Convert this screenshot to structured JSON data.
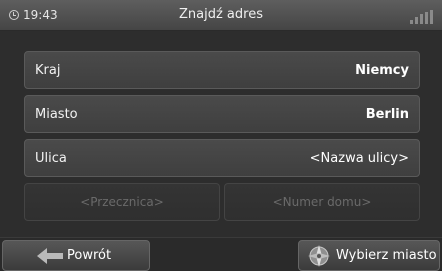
{
  "status": {
    "time": "19:43",
    "title": "Znajdź adres",
    "clock_icon": "clock-icon",
    "signal_icon": "signal-icon"
  },
  "form": {
    "rows": [
      {
        "label": "Kraj",
        "value": "Niemcy"
      },
      {
        "label": "Miasto",
        "value": "Berlin"
      },
      {
        "label": "Ulica",
        "value": "<Nazwa ulicy>"
      }
    ],
    "cross_street_placeholder": "<Przecznica>",
    "house_number_placeholder": "<Numer domu>"
  },
  "footer": {
    "back_label": "Powrót",
    "back_icon": "arrow-left-icon",
    "select_city_label": "Wybierz miasto",
    "select_city_icon": "compass-icon"
  },
  "colors": {
    "background": "#2d2d2d",
    "row": "#444444",
    "disabled_text": "#6a6a6a"
  }
}
